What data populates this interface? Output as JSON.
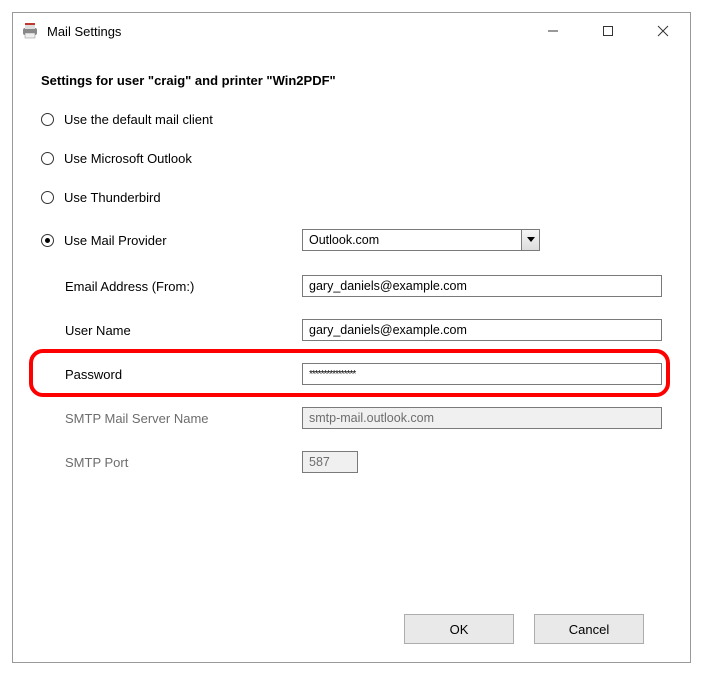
{
  "window": {
    "title": "Mail Settings"
  },
  "heading": "Settings for user \"craig\" and printer \"Win2PDF\"",
  "radios": {
    "default_client": "Use the default mail client",
    "outlook": "Use Microsoft Outlook",
    "thunderbird": "Use Thunderbird",
    "provider": "Use Mail Provider"
  },
  "provider_select": {
    "value": "Outlook.com"
  },
  "fields": {
    "email_label": "Email Address (From:)",
    "email_value": "gary_daniels@example.com",
    "user_label": "User Name",
    "user_value": "gary_daniels@example.com",
    "password_label": "Password",
    "password_value": "****************",
    "smtp_server_label": "SMTP Mail Server Name",
    "smtp_server_value": "smtp-mail.outlook.com",
    "smtp_port_label": "SMTP Port",
    "smtp_port_value": "587"
  },
  "buttons": {
    "ok": "OK",
    "cancel": "Cancel"
  }
}
